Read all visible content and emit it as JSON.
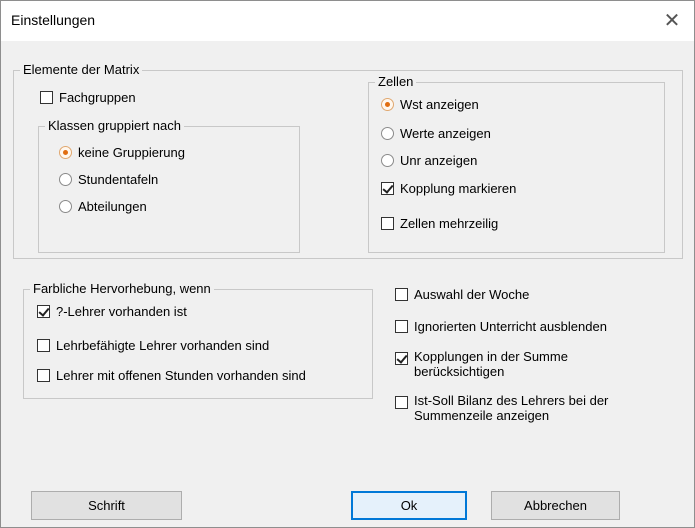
{
  "window": {
    "title": "Einstellungen",
    "close_glyph": "✕"
  },
  "matrix": {
    "legend": "Elemente der Matrix",
    "fachgruppen": {
      "label": "Fachgruppen",
      "checked": false
    },
    "klassen": {
      "legend": "Klassen gruppiert nach",
      "options": [
        {
          "label": "keine Gruppierung",
          "checked": true
        },
        {
          "label": "Stundentafeln",
          "checked": false
        },
        {
          "label": "Abteilungen",
          "checked": false
        }
      ]
    },
    "zellen": {
      "legend": "Zellen",
      "radios": [
        {
          "label": "Wst anzeigen",
          "checked": true
        },
        {
          "label": "Werte anzeigen",
          "checked": false
        },
        {
          "label": "Unr anzeigen",
          "checked": false
        }
      ],
      "kopplung": {
        "label": "Kopplung markieren",
        "checked": true
      },
      "mehrzeilig": {
        "label": "Zellen mehrzeilig",
        "checked": false
      }
    }
  },
  "farblich": {
    "legend": "Farbliche Hervorhebung, wenn",
    "options": [
      {
        "label": "?-Lehrer vorhanden ist",
        "checked": true
      },
      {
        "label": "Lehrbefähigte Lehrer vorhanden sind",
        "checked": false
      },
      {
        "label": "Lehrer mit offenen Stunden vorhanden sind",
        "checked": false
      }
    ]
  },
  "right_options": {
    "auswahl": {
      "label": "Auswahl der Woche",
      "checked": false
    },
    "ignoriert": {
      "label": "Ignorierten Unterricht ausblenden",
      "checked": false
    },
    "kopplungen": {
      "line1": "Kopplungen in der Summe",
      "line2": "berücksichtigen",
      "checked": true
    },
    "bilanz": {
      "line1": "Ist-Soll Bilanz des Lehrers bei der",
      "line2": "Summenzeile anzeigen",
      "checked": false
    }
  },
  "buttons": {
    "schrift": "Schrift",
    "ok": "Ok",
    "abbrechen": "Abbrechen"
  },
  "colors": {
    "dialog_bg": "#f0f0f0",
    "title_bg": "#ffffff",
    "accent": "#0078d7",
    "radio_dot": "#e06d10"
  }
}
